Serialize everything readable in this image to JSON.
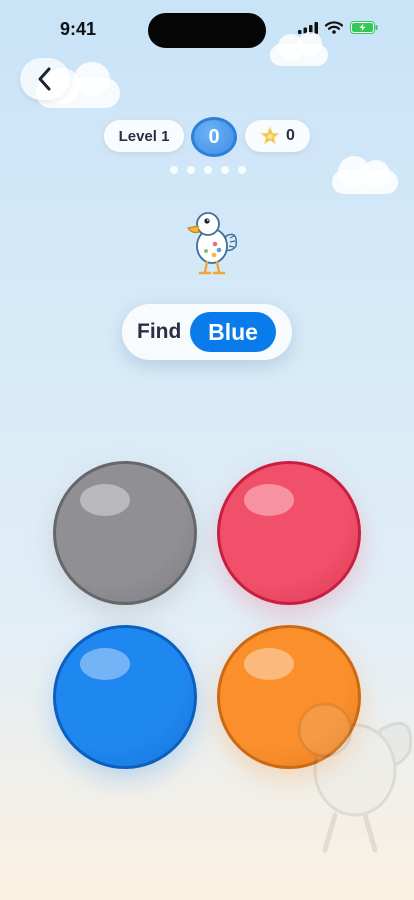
{
  "status_bar": {
    "time": "9:41"
  },
  "header": {
    "back_icon": "chevron-left-icon"
  },
  "hud": {
    "level_label": "Level 1",
    "score": "0",
    "star_icon": "star-icon",
    "stars": "0",
    "progress_dots": 5
  },
  "prompt": {
    "label": "Find",
    "target_color": "Blue"
  },
  "balloons": [
    {
      "color_name": "gray",
      "fill": "#8f8f94",
      "border": "#66666b"
    },
    {
      "color_name": "pink",
      "fill": "#f0506a",
      "border": "#c91f3f"
    },
    {
      "color_name": "blue",
      "fill": "#1f87f0",
      "border": "#0c5fbf"
    },
    {
      "color_name": "orange",
      "fill": "#fa8f2c",
      "border": "#cc6a14"
    }
  ],
  "colors": {
    "accent_blue": "#0a7bea",
    "score_blue": "#3a8ee6"
  }
}
